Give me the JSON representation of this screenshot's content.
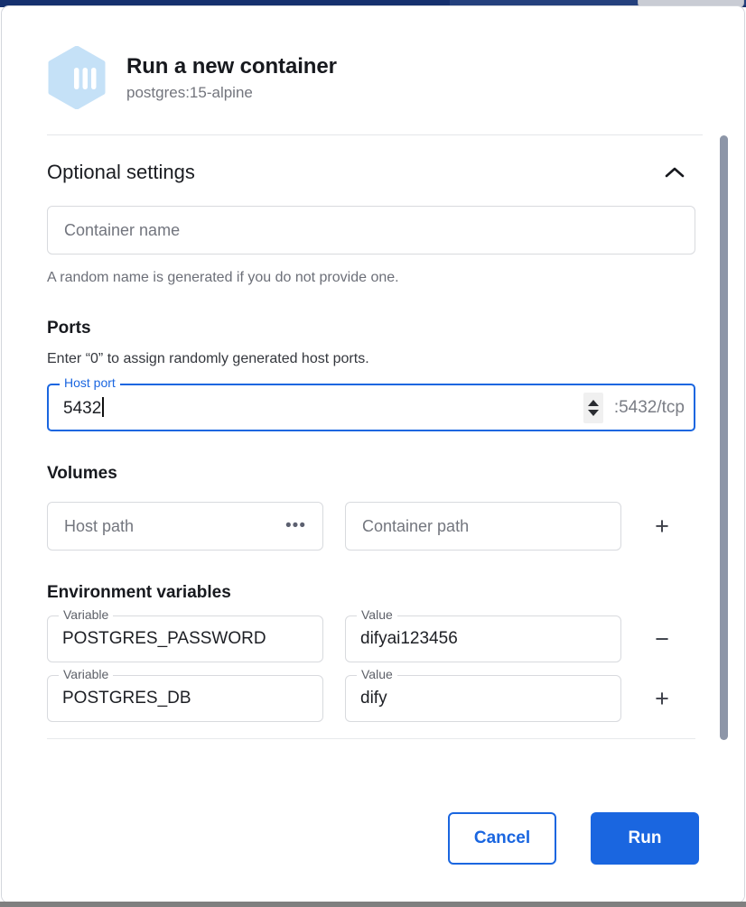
{
  "dialog": {
    "icon": "container-hexagon-icon",
    "title": "Run a new container",
    "subtitle": "postgres:15-alpine"
  },
  "optional_settings": {
    "heading": "Optional settings",
    "collapse_icon": "chevron-up-icon",
    "container_name": {
      "placeholder": "Container name",
      "value": "",
      "helper": "A random name is generated if you do not provide one."
    },
    "ports": {
      "heading": "Ports",
      "note": "Enter “0” to assign randomly generated host ports.",
      "host_port_label": "Host port",
      "host_port_value": "5432",
      "spinner_icon": "spinner-up-down-icon",
      "suffix": ":5432/tcp"
    },
    "volumes": {
      "heading": "Volumes",
      "host_path_placeholder": "Host path",
      "browse_icon": "ellipsis-icon",
      "container_path_placeholder": "Container path",
      "add_icon": "plus-icon"
    },
    "environment_variables": {
      "heading": "Environment variables",
      "variable_label": "Variable",
      "value_label": "Value",
      "rows": [
        {
          "variable": "POSTGRES_PASSWORD",
          "value": "difyai123456",
          "action_icon": "minus-icon",
          "action": "−"
        },
        {
          "variable": "POSTGRES_DB",
          "value": "dify",
          "action_icon": "plus-icon",
          "action": "+"
        }
      ]
    }
  },
  "footer": {
    "cancel_label": "Cancel",
    "run_label": "Run"
  },
  "colors": {
    "accent_blue": "#1a66e0",
    "window_navy": "#15306e",
    "icon_fill": "#c5e1f7",
    "scrollbar": "#8d96a8"
  }
}
